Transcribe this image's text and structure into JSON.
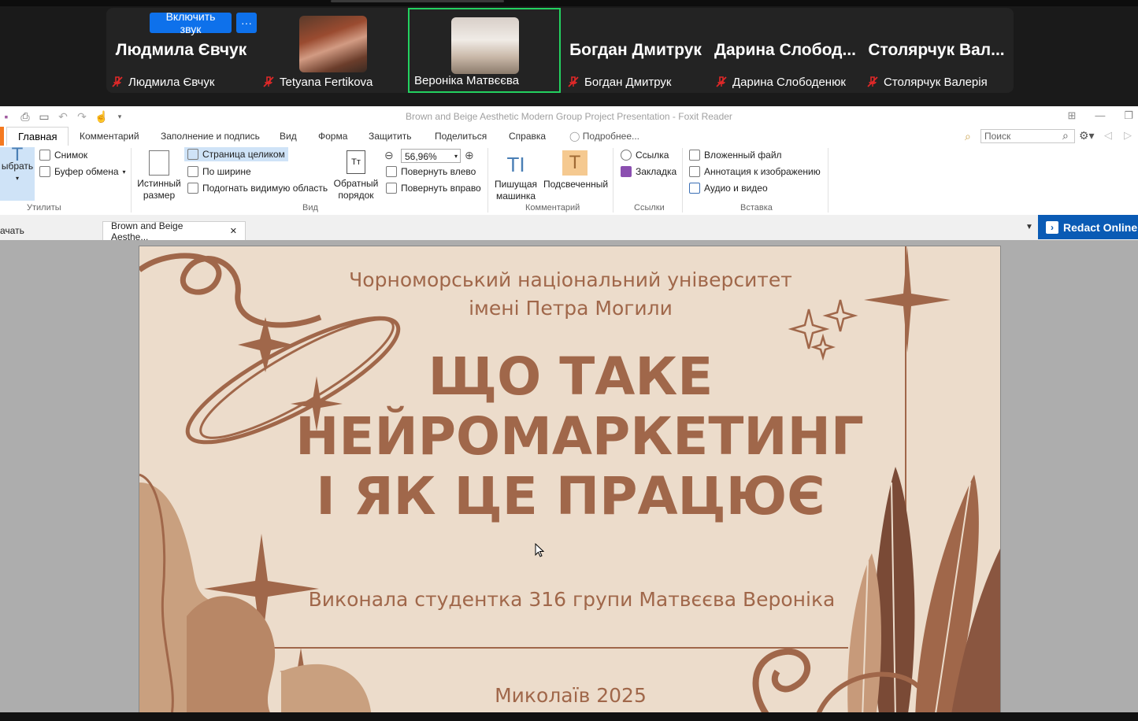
{
  "zoom": {
    "unmute_label": "Включить звук",
    "more_label": "···",
    "participants": [
      {
        "big_name": "Людмила Євчук",
        "name": "Людмила Євчук"
      },
      {
        "big_name": "",
        "name": "Tetyana Fertikova"
      },
      {
        "big_name": "",
        "name": "Вероніка Матвєєва"
      },
      {
        "big_name": "Богдан Дмитрук",
        "name": "Богдан Дмитрук"
      },
      {
        "big_name": "Дарина  Слобод...",
        "name": "Дарина Слободенюк"
      },
      {
        "big_name": "Столярчук  Вал...",
        "name": "Столярчук Валерія"
      }
    ]
  },
  "app": {
    "window_title": "Brown and Beige Aesthetic Modern Group Project Presentation - Foxit Reader",
    "menu": [
      "Главная",
      "Комментарий",
      "Заполнение и подпись",
      "Вид",
      "Форма",
      "Защитить",
      "Поделиться",
      "Справка",
      "Подробнее..."
    ],
    "search_placeholder": "Поиск",
    "ribbon": {
      "select_label": "ыбрать",
      "snapshot": "Снимок",
      "clipboard": "Буфер обмена",
      "utilities": "Утилиты",
      "actual_size_1": "Истинный",
      "actual_size_2": "размер",
      "fit_page": "Страница целиком",
      "fit_width": "По ширине",
      "fit_visible": "Подогнать видимую область",
      "reverse_1": "Обратный",
      "reverse_2": "порядок",
      "zoom_value": "56,96%",
      "rotate_left": "Повернуть влево",
      "rotate_right": "Повернуть вправо",
      "view_group": "Вид",
      "typewriter_1": "Пишущая",
      "typewriter_2": "машинка",
      "highlight": "Подсвеченный",
      "comments_group": "Комментарий",
      "link": "Ссылка",
      "bookmark": "Закладка",
      "links_group": "Ссылки",
      "attached_file": "Вложенный файл",
      "image_annotation": "Аннотация к изображению",
      "audio_video": "Аудио и видео",
      "insert_group": "Вставка"
    },
    "tabs": {
      "start": "ачать",
      "doc": "Brown and Beige Aesthe...",
      "close": "✕"
    },
    "redact": "Redact Online"
  },
  "slide": {
    "university_1": "Чорноморський національний університет",
    "university_2": "імені Петра Могили",
    "title_1": "ЩО ТАКЕ",
    "title_2": "НЕЙРОМАРКЕТИНГ",
    "title_3": "І ЯК ЦЕ ПРАЦЮЄ",
    "author": "Виконала студентка 316 групи Матвєєва Вероніка",
    "city_year": "Миколаїв 2025"
  },
  "colors": {
    "slide_bg": "#ecdccb",
    "slide_accent": "#a0674a",
    "zoom_blue": "#0e71eb",
    "active_speaker": "#23d160"
  }
}
